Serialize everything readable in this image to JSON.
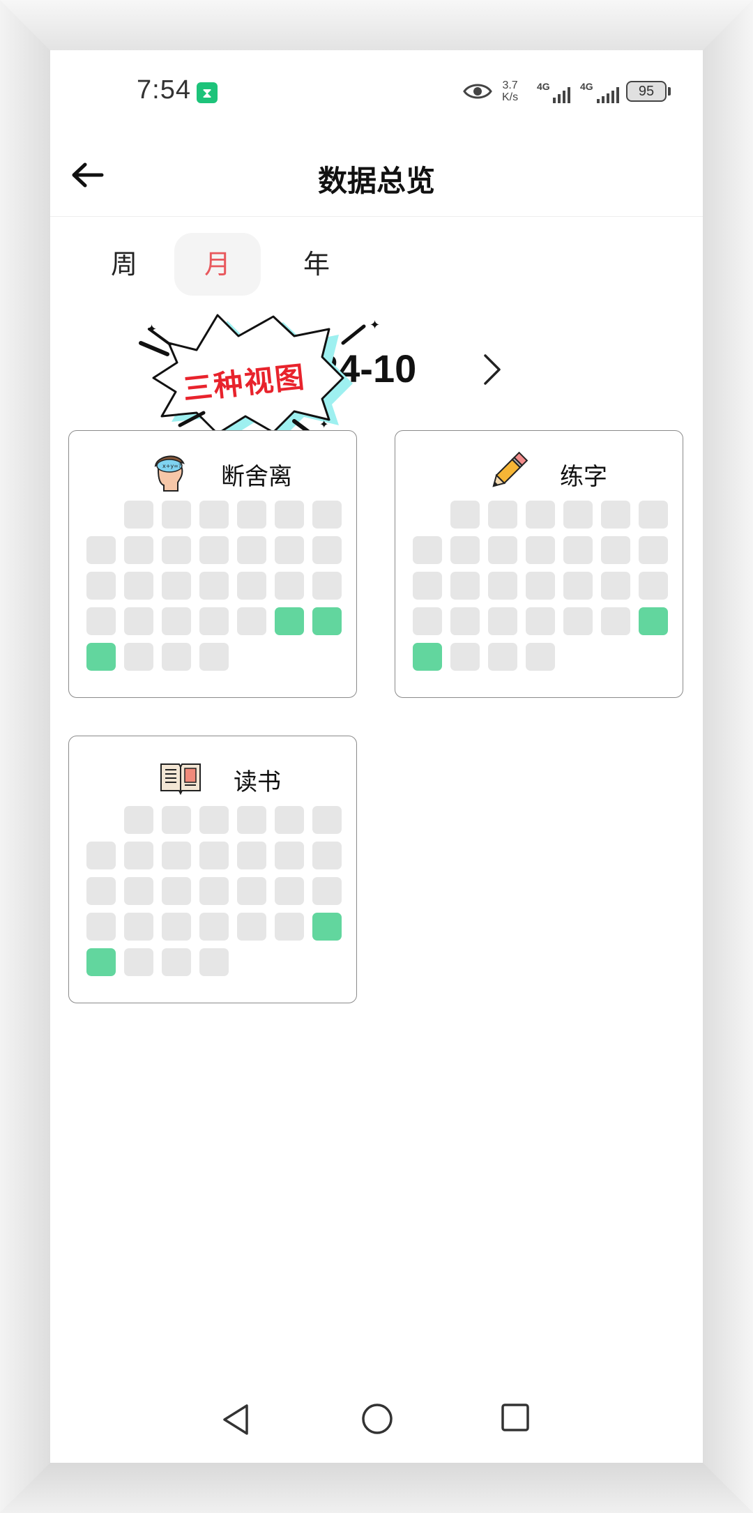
{
  "status_bar": {
    "time": "7:54",
    "network_speed_value": "3.7",
    "network_speed_unit": "K/s",
    "signal1_label": "4G",
    "signal2_label": "4G",
    "battery": "95"
  },
  "header": {
    "title": "数据总览"
  },
  "tabs": [
    {
      "label": "周",
      "active": false
    },
    {
      "label": "月",
      "active": true
    },
    {
      "label": "年",
      "active": false
    }
  ],
  "period": {
    "label": "24-10"
  },
  "sticker": {
    "text": "三种视图"
  },
  "colors": {
    "done": "#62d69e",
    "empty": "#e6e6e6",
    "active_tab": "#e8585d"
  },
  "habits": [
    {
      "title": "断舍离",
      "icon": "thinking-head-icon",
      "leading_blank_days": 1,
      "days_in_month": 31,
      "done_days": [
        26,
        27,
        28
      ]
    },
    {
      "title": "练字",
      "icon": "pencil-icon",
      "leading_blank_days": 1,
      "days_in_month": 31,
      "done_days": [
        27,
        28
      ]
    },
    {
      "title": "读书",
      "icon": "open-book-icon",
      "leading_blank_days": 1,
      "days_in_month": 31,
      "done_days": [
        27,
        28
      ]
    }
  ]
}
